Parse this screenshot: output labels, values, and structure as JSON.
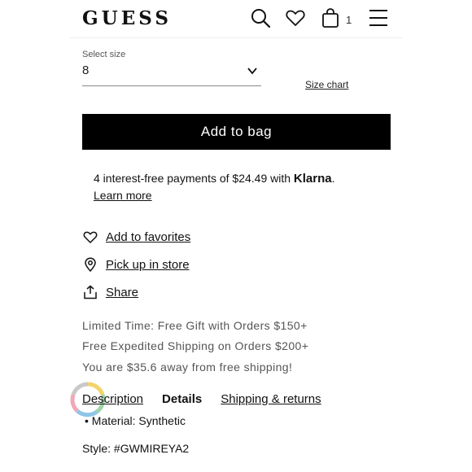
{
  "header": {
    "logo": "GUESS",
    "cart_count": "1",
    "icons": [
      "search-icon",
      "heart-icon",
      "bag-icon",
      "menu-icon"
    ]
  },
  "size": {
    "label": "Select size",
    "value": "8",
    "size_chart": "Size chart"
  },
  "add_to_bag": "Add to bag",
  "klarna": {
    "text": "4 interest-free payments of $24.49 with ",
    "brand": "Klarna",
    "period": ".",
    "learn_more": "Learn more"
  },
  "actions": {
    "favorites": "Add to favorites",
    "pickup": "Pick up in store",
    "share": "Share"
  },
  "promos": [
    "Limited Time: Free Gift with Orders $150+",
    "Free Expedited Shipping on Orders $200+",
    "You are $35.6 away from free shipping!"
  ],
  "tabs": {
    "description": "Description",
    "details": "Details",
    "shipping": "Shipping & returns"
  },
  "details": {
    "material": "• Material: Synthetic",
    "style": "Style: #GWMIREYA2"
  },
  "colors": {
    "button_bg": "#000000",
    "button_text": "#ffffff",
    "muted_text": "#555555"
  }
}
